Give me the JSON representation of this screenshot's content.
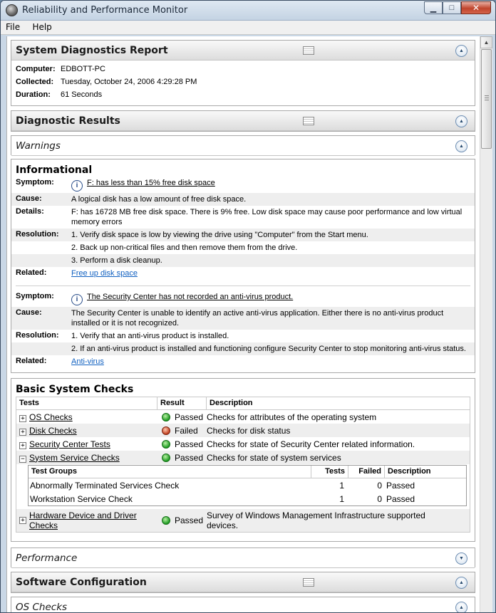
{
  "window": {
    "title": "Reliability and Performance Monitor"
  },
  "menu": [
    "File",
    "Help"
  ],
  "report": {
    "title": "System Diagnostics Report",
    "fields": [
      {
        "label": "Computer:",
        "value": "EDBOTT-PC"
      },
      {
        "label": "Collected:",
        "value": "Tuesday, October 24, 2006 4:29:28 PM"
      },
      {
        "label": "Duration:",
        "value": "61 Seconds"
      }
    ]
  },
  "diagnostic_results": {
    "title": "Diagnostic Results"
  },
  "warnings": {
    "title": "Warnings"
  },
  "informational": {
    "title": "Informational",
    "labels": {
      "symptom": "Symptom:",
      "cause": "Cause:",
      "details": "Details:",
      "resolution": "Resolution:",
      "related": "Related:"
    },
    "items": [
      {
        "symptom": "F: has less than 15% free disk space",
        "cause": "A logical disk has a low amount of free disk space.",
        "details": "F: has 16728 MB free disk space. There is 9% free. Low disk space may cause poor performance and low virtual memory errors",
        "resolution": [
          "1. Verify disk space is low by viewing the drive using \"Computer\" from the Start menu.",
          "2. Back up non-critical files and then remove them from the drive.",
          "3. Perform a disk cleanup."
        ],
        "related": "Free up disk space"
      },
      {
        "symptom": "The Security Center has not recorded an anti-virus product.",
        "cause": "The Security Center is unable to identify an active anti-virus application. Either there is no anti-virus product installed or it is not recognized.",
        "resolution": [
          "1. Verify that an anti-virus product is installed.",
          "2. If an anti-virus product is installed and functioning configure Security Center to stop monitoring anti-virus status."
        ],
        "related": "Anti-virus"
      }
    ]
  },
  "basic_checks": {
    "title": "Basic System Checks",
    "columns": [
      "Tests",
      "Result",
      "Description"
    ],
    "rows": [
      {
        "test": "OS Checks",
        "expander": "+",
        "status": "ok",
        "result": "Passed",
        "description": "Checks for attributes of the operating system"
      },
      {
        "test": "Disk Checks",
        "expander": "+",
        "status": "fail",
        "result": "Failed",
        "description": "Checks for disk status"
      },
      {
        "test": "Security Center Tests",
        "expander": "+",
        "status": "ok",
        "result": "Passed",
        "description": "Checks for state of Security Center related information."
      },
      {
        "test": "System Service Checks",
        "expander": "−",
        "status": "ok",
        "result": "Passed",
        "description": "Checks for state of system services"
      }
    ],
    "sub": {
      "columns": [
        "Test Groups",
        "Tests",
        "Failed",
        "Description"
      ],
      "rows": [
        {
          "group": "Abnormally Terminated Services Check",
          "tests": "1",
          "failed": "0",
          "description": "Passed"
        },
        {
          "group": "Workstation Service Check",
          "tests": "1",
          "failed": "0",
          "description": "Passed"
        }
      ]
    },
    "last_row": {
      "test": "Hardware Device and Driver Checks",
      "expander": "+",
      "status": "ok",
      "result": "Passed",
      "description": "Survey of Windows Management Infrastructure supported devices."
    }
  },
  "performance": {
    "title": "Performance"
  },
  "software_configuration": {
    "title": "Software Configuration"
  },
  "os_checks": {
    "title": "OS Checks"
  }
}
